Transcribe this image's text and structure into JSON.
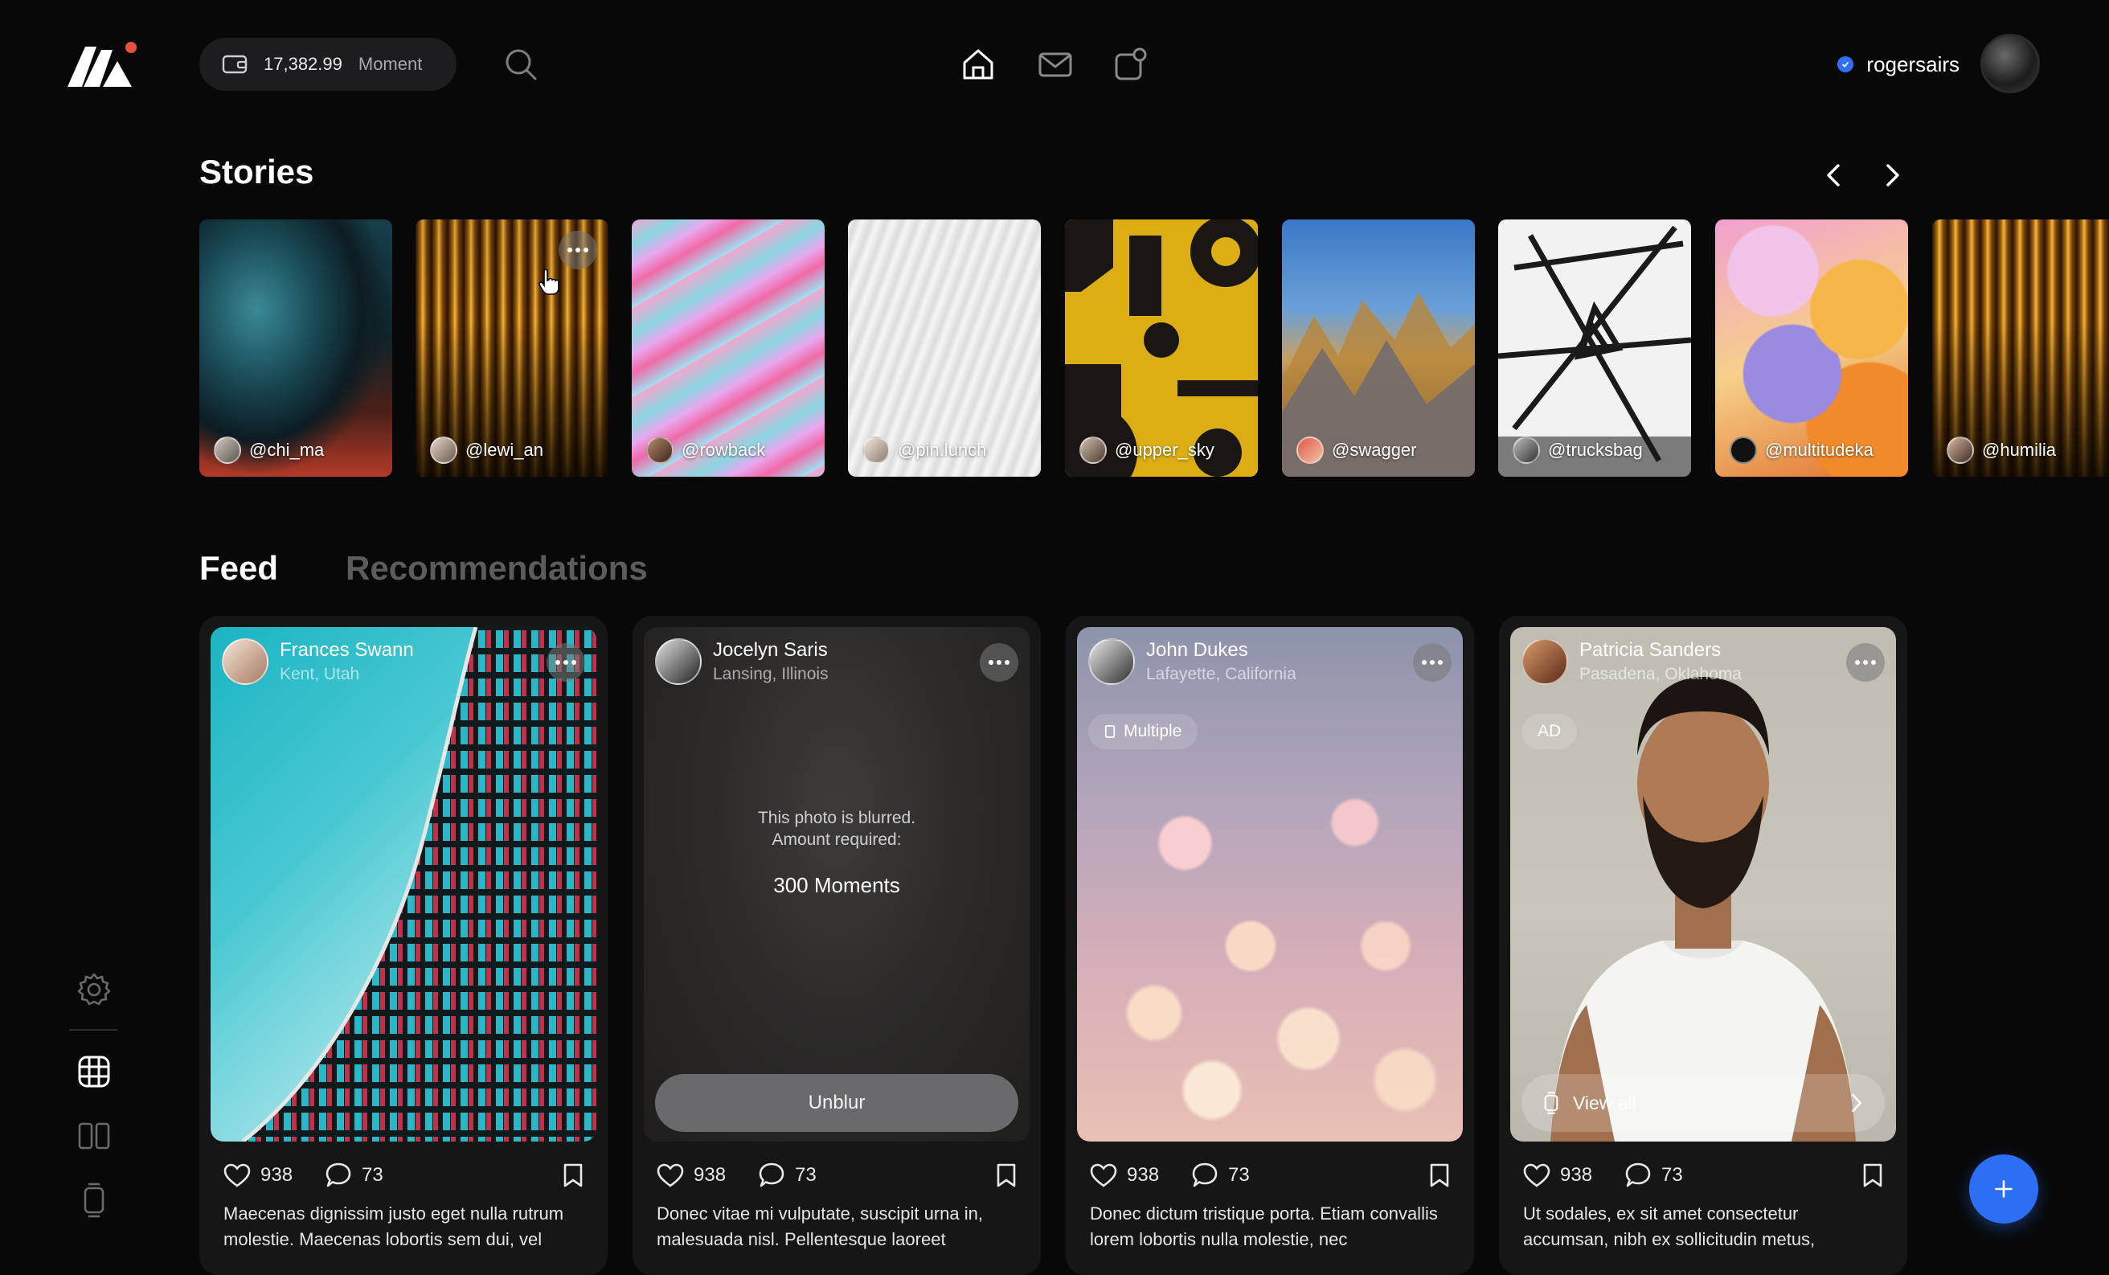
{
  "header": {
    "balance_amount": "17,382.99",
    "balance_unit": "Moment",
    "username": "rogersairs"
  },
  "stories": {
    "title": "Stories",
    "items": [
      {
        "handle": "@chi_ma"
      },
      {
        "handle": "@lewi_an"
      },
      {
        "handle": "@rowback"
      },
      {
        "handle": "@pin.lunch"
      },
      {
        "handle": "@upper_sky"
      },
      {
        "handle": "@swagger"
      },
      {
        "handle": "@trucksbag"
      },
      {
        "handle": "@multitudeka"
      },
      {
        "handle": "@humilia"
      }
    ]
  },
  "tabs": {
    "feed": "Feed",
    "recommendations": "Recommendations"
  },
  "posts": [
    {
      "name": "Frances Swann",
      "location": "Kent, Utah",
      "likes": "938",
      "comments": "73",
      "caption": "Maecenas dignissim justo eget nulla rutrum molestie. Maecenas lobortis sem dui, vel"
    },
    {
      "name": "Jocelyn Saris",
      "location": "Lansing, Illinois",
      "blur_message": "This photo is blurred.",
      "blur_required": "Amount required:",
      "blur_amount": "300 Moments",
      "unblur_label": "Unblur",
      "likes": "938",
      "comments": "73",
      "caption": "Donec vitae mi vulputate, suscipit urna in, malesuada nisl. Pellentesque laoreet"
    },
    {
      "name": "John Dukes",
      "location": "Lafayette, California",
      "chip": "Multiple",
      "likes": "938",
      "comments": "73",
      "caption": "Donec dictum tristique porta. Etiam convallis lorem lobortis nulla molestie, nec"
    },
    {
      "name": "Patricia Sanders",
      "location": "Pasadena, Oklahoma",
      "chip": "AD",
      "view_all": "View all",
      "likes": "938",
      "comments": "73",
      "caption": "Ut sodales, ex sit amet consectetur accumsan, nibh ex sollicitudin metus,"
    }
  ],
  "fab_label": "+",
  "colors": {
    "background": "#080808",
    "accent": "#2d6ff2",
    "notification": "#e8513d"
  }
}
